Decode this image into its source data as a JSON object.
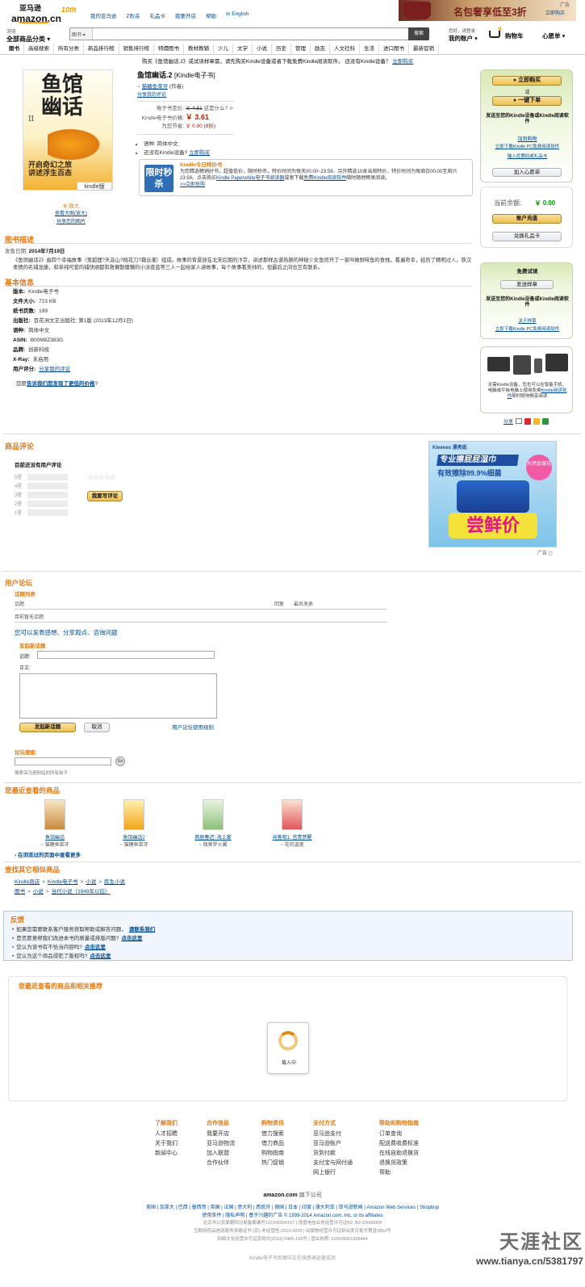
{
  "header": {
    "logo_cn": "亚马逊",
    "logo_en": "amazon.cn",
    "logo_badge": "10th",
    "top_links": [
      "我的亚马逊",
      "Z秒杀",
      "礼品卡",
      "我要开店",
      "帮助",
      "In English"
    ],
    "ad_banner_text": "名包奢享低至3折",
    "ad_label": "广告",
    "ad_link": "立即购买",
    "browse_label": "浏览",
    "browse_all": "全部商品分类",
    "search_scope": "图书",
    "search_placeholder": "",
    "search_button": "搜索",
    "greeting": "您好，请登录",
    "my_account": "我的账户",
    "cart_label": "购物车",
    "cart_count": "0",
    "wishlist": "心愿单",
    "nav_items": [
      "图书",
      "高级搜索",
      "所有分类",
      "新品排行榜",
      "销售排行榜",
      "特價图书",
      "教材教辅",
      "少儿",
      "文学",
      "小说",
      "历史",
      "管理",
      "励志",
      "人文社科",
      "生活",
      "进口图书",
      "最新促销"
    ]
  },
  "notice": {
    "text": "购买《鱼馆幽话.2》或试读样章需，请先购买Kindle设备或者下载免费Kindle阅读软件。 还没有Kindle设备？",
    "link": "立即购买"
  },
  "product": {
    "cover_title": "鱼馆幽话",
    "cover_volume": "II",
    "cover_tagline": "开启奇幻之旅 讲述浮生百态",
    "kindle_badge": "kindle版",
    "zoom_label": "放大",
    "zoom_link": "查看大图(放大)",
    "share_img": "共享您的图片",
    "title": "鱼馆幽话.2",
    "format": "[Kindle电子书]",
    "author_prefix": "~",
    "author": "猫糖鱼菜牙",
    "author_role": "(作者)",
    "first_review": "分享我的评论",
    "price_list_label": "电子书定价:",
    "price_list": "￥ 4.51",
    "price_whats": "这是什么?",
    "price_kindle_label": "Kindle电子书价格:",
    "price_kindle": "￥ 3.61",
    "price_save_label": "为您节省:",
    "price_save": "￥ 0.90 (8折)",
    "bullets": [
      {
        "text": "语种:  简体中文",
        "link": ""
      },
      {
        "text": "还没有Kindle设备?",
        "link": "立即购买"
      }
    ],
    "deal_badge": "限时秒杀",
    "deal_title": "Kindle今日特价书",
    "deal_text_1": "为您精选畅销好书，超值低价，限时秒杀，特价时间为每天00:00~23:59，另外精选10本当周特价，特价时间为每周日00:00至周六23:59。点击购买",
    "deal_link_1": "Kindle Paperwhite电子书阅读器",
    "deal_text_2": "或者下载",
    "deal_link_2": "免费Kindle阅读软件",
    "deal_text_3": "随时随地畅享阅读。",
    "deal_more": ">>立即抢购"
  },
  "buybox": {
    "buy_now": "立即购买",
    "or": "或",
    "one_click": "一键下单",
    "send_to": "发送至您的Kindle设备或Kindle阅读软件",
    "add_gift": "加到购物",
    "pc_reader": "立即下载Kindle PC免费阅读软件",
    "redeem": "输入优惠码或礼品卡",
    "wishlist": "加入心愿单",
    "balance_label": "当前余额:",
    "balance": "￥ 0.00",
    "recharge": "账户充值",
    "redeem_card": "兑换礼品卡",
    "trial_title": "免费试读",
    "send_sample": "发送样章",
    "send_sample_text": "发送至您的Kindle设备或Kindle阅读软件",
    "about_sample": "关于样章",
    "pc_download": "立即下载Kindle PC免费阅读软件",
    "device_text": "无需Kindle设备，您也可以在智能手机、电脑或平板电脑上使用免费",
    "device_link": "Kindle阅读软件",
    "device_text2": "随时随地畅享阅读",
    "share_label": "分享"
  },
  "description": {
    "heading": "图书描述",
    "date_label": "发售日期:",
    "date": "2014年7月19日",
    "text": "《鱼馆幽话2》由四个幸福故事（鬼狐狸?天音山?桃花刀?霜云潮）组成。故事的背景放在北宋后期的汴京，讲述那样古道热肠的神秘少女鱼馆开了一家叫做鲜味鱼的食栈，看遍奇幸，经历了精明过人，铁汉柔情的名捕龙捷，和单纯可爱的捕快顺都和救懒散慵懒的小派夜蓝等三人一起给家人讲故事，每个故事看美帅的，但最后之间也互有联系。"
  },
  "basic_info": {
    "heading": "基本信息",
    "rows": [
      {
        "label": "版本:",
        "value": "Kindle电子书"
      },
      {
        "label": "文件大小:",
        "value": "723 KB"
      },
      {
        "label": "纸书页数:",
        "value": "199"
      },
      {
        "label": "出版社:",
        "value": "百花洲文艺出版社; 第1版 (2013年12月1日)"
      },
      {
        "label": "语种:",
        "value": "简体中文"
      },
      {
        "label": "ASIN:",
        "value": "B00M8Z383G"
      },
      {
        "label": "品牌:",
        "value": "创新科技"
      },
      {
        "label": "X-Ray:",
        "value": "未启用"
      },
      {
        "label": "用户评分:",
        "value": "分享我的评论"
      }
    ],
    "price_tip_prefix": "您愿",
    "price_tip_link": "告诉我们您发现了更低的价格",
    "price_tip_suffix": "?"
  },
  "reviews": {
    "heading": "商品评论",
    "subheading": "目前还没有用户评论",
    "stars": [
      "5星",
      "4星",
      "3星",
      "2星",
      "1星"
    ],
    "star_glyphs": "☆☆☆☆☆",
    "write_review": "我要写评论",
    "ad_brand": "Kleenex 漂亮纸",
    "ad_line1": "专业擦屁屁湿巾",
    "ad_line2": "有效擦除99.9%细菌",
    "ad_badge": "天然金银花",
    "ad_slogan": "尝鲜价",
    "ad_label": "广告"
  },
  "forum": {
    "heading": "用户论坛",
    "topics_heading": "话题列表",
    "col_topic": "话题",
    "col_replies": "回复",
    "col_latest": "最后发表",
    "no_topics": "目前暂无话题",
    "prompt": "您可以发表感想、分享观点、咨询问题",
    "new_topic_heading": "发起新话题",
    "topic_label": "话题:",
    "body_label": "正文:",
    "submit": "发起新话题",
    "cancel": "取消",
    "guidelines": "用户论坛使用规则",
    "search_heading": "论坛搜索",
    "search_button": "Go",
    "search_hint": "搜索亚马逊网站的所有帖子"
  },
  "recent": {
    "heading": "您最近查看的商品",
    "items": [
      {
        "title": "鱼馆幽话",
        "author": "~ 猫糖鱼菜牙"
      },
      {
        "title": "鱼馆幽话2",
        "author": "~ 猫糖鱼菜牙"
      },
      {
        "title": "燕居春迟: 海上宴",
        "author": "~ 微葵罗火翼"
      },
      {
        "title": "闲客相1: 宫青梦醒",
        "author": "~ 花的温度"
      }
    ],
    "history_link": "在浏览过的页面中查看更多"
  },
  "similar": {
    "heading": "查找其它相似商品",
    "path1": [
      "Kindle商店",
      "Kindle电子书",
      "小说",
      "民生小说"
    ],
    "path2": [
      "图书",
      "小说",
      "当代小说（1949年以后）"
    ]
  },
  "feedback": {
    "heading": "反馈",
    "rows": [
      {
        "text": "如果您需要联系客户服务获取帮助或解答问题，",
        "link": "请联系我们"
      },
      {
        "text": "是否愿意帮我们改进本书的质量或排版问题?",
        "link": "点击这里"
      },
      {
        "text": "您认为该书有不恰当内容吗?",
        "link": "点击这里"
      },
      {
        "text": "您认为这个商品侵犯了版权吗?",
        "link": "点击这里"
      }
    ]
  },
  "recommend": {
    "heading": "您最近查看的商品和相关推荐",
    "loading": "载入中"
  },
  "footer": {
    "columns": [
      {
        "title": "了解我们",
        "items": [
          "人才招聘",
          "关于我们",
          "新闻中心"
        ]
      },
      {
        "title": "合作信息",
        "items": [
          "我要开店",
          "亚马逊物流",
          "加入联盟",
          "合作伙伴"
        ]
      },
      {
        "title": "购物资讯",
        "items": [
          "借力搜索",
          "借力商品",
          "购物指南",
          "热门促销"
        ]
      },
      {
        "title": "支付方式",
        "items": [
          "亚马逊支付",
          "亚马逊账户",
          "货到付款",
          "支付宝与网付通",
          "网上银行"
        ]
      },
      {
        "title": "帮助和购物指南",
        "items": [
          "订单查询",
          "配送费收费标准",
          "在线自助退换货",
          "退换货政策",
          "帮助"
        ]
      }
    ],
    "amazon_brand": "amazon.com",
    "amazon_sub": "旗下公司",
    "country_links": "美国 | 加拿大 | 巴西 | 墨西哥 | 英国 | 法国 | 意大利 | 西班牙 | 德国 | 日本 | 印度 | 澳大利亚 | 亚马逊新闻 | Amazon Web Services | Shopbop",
    "legal_1": "使用条件 | 隐私声明 | 基于兴趣的广告 © 1999-2014 Amazon.com, Inc. or its affiliates",
    "legal_2": "北京市公安局朝阳分局备案编号110105004157 | 增值电信业务经营许可证B2- B2-20090004",
    "legal_3": "互联网药品信息服务资格证书 (京)-非经营性-2012-0005 | 出版物经营许可证新出发京批字第直0852号",
    "legal_4": "网络文化经营许可证京网文[2012] 0405-126号 | 营业执照: 110105001308484",
    "bottom": "Kindle电子书页面中文在线感谢运营支持",
    "watermark_big": "天涯社区",
    "watermark_url": "www.tianya.cn/5381797"
  },
  "colors": {
    "orange": "#e47911",
    "link": "#004b91",
    "price_red": "#b12704",
    "buy_green": "#c3d99a"
  }
}
